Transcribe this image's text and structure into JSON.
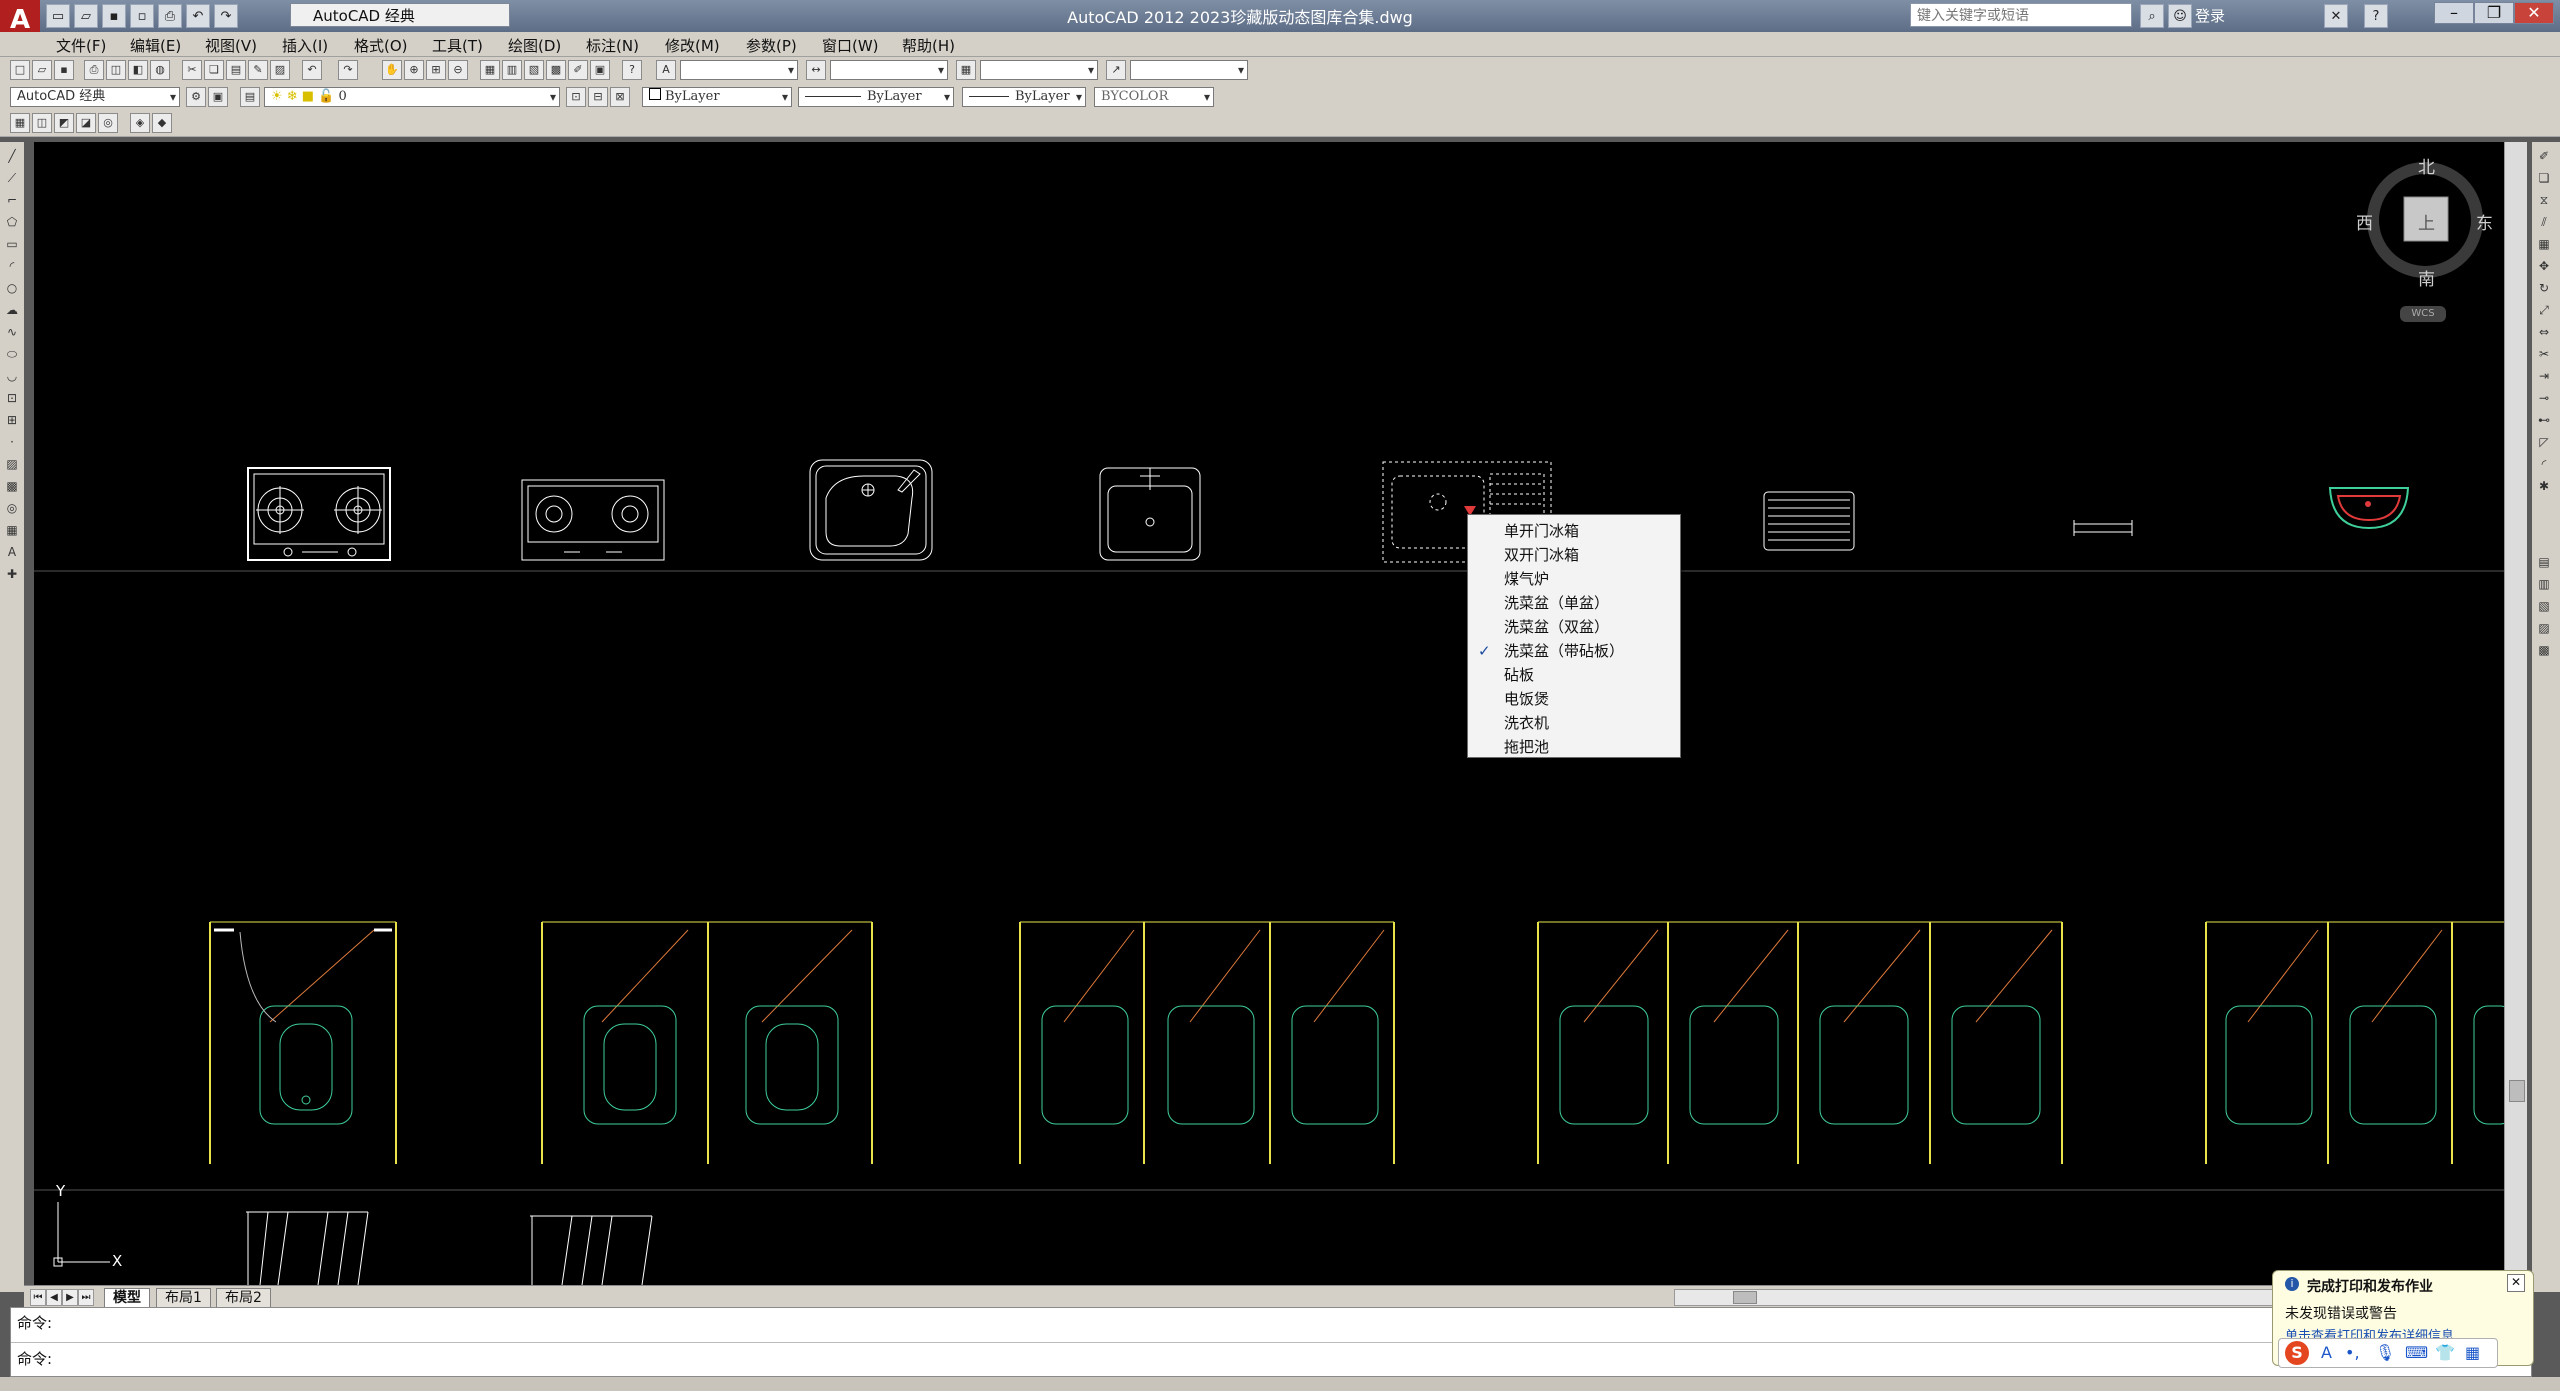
{
  "app": {
    "logo": "A",
    "title": "AutoCAD 2012    2023珍藏版动态图库合集.dwg",
    "workspace": "AutoCAD 经典",
    "search_placeholder": "键入关键字或短语",
    "login": "登录"
  },
  "menu": [
    "文件(F)",
    "编辑(E)",
    "视图(V)",
    "插入(I)",
    "格式(O)",
    "工具(T)",
    "绘图(D)",
    "标注(N)",
    "修改(M)",
    "参数(P)",
    "窗口(W)",
    "帮助(H)"
  ],
  "toolbar": {
    "workspace_combo": "AutoCAD 经典",
    "layer_combo": "0",
    "color_combo": "ByLayer",
    "linetype_combo": "ByLayer",
    "lineweight_combo": "ByLayer",
    "plotstyle_combo": "BYCOLOR"
  },
  "viewcube": {
    "north": "北",
    "south": "南",
    "east": "东",
    "west": "西",
    "face": "上",
    "wcs": "WCS"
  },
  "context_menu": {
    "items": [
      "单开门冰箱",
      "双开门冰箱",
      "煤气炉",
      "洗菜盆（单盆）",
      "洗菜盆（双盆）",
      "洗菜盆（带砧板）",
      "砧板",
      "电饭煲",
      "洗衣机",
      "拖把池"
    ],
    "checked_index": 5
  },
  "ucs": {
    "y": "Y",
    "x": "X"
  },
  "tabs": [
    "模型",
    "布局1",
    "布局2"
  ],
  "command": {
    "line1": "命令:",
    "line2": "命令:"
  },
  "notification": {
    "title": "完成打印和发布作业",
    "body": "未发现错误或警告",
    "link": "单击查看打印和发布详细信息"
  },
  "colors": {
    "canvas": "#000000",
    "cad_green": "#3ecf9a",
    "cad_yellow": "#e8e34a",
    "cad_red": "#e03a3a"
  }
}
